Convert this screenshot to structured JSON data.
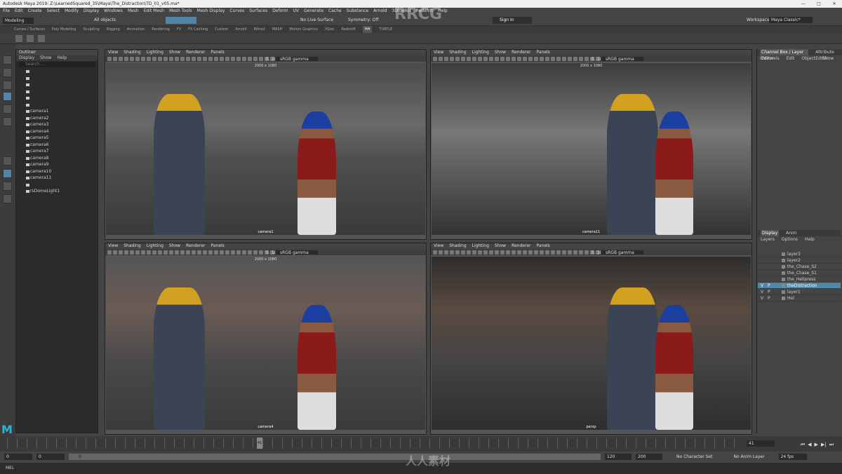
{
  "window": {
    "title": "Autodesk Maya 2019: Z:\\LearnedSquared_35\\Maya\\The_Distraction\\TD_01_v05.ma*",
    "min": "—",
    "max": "□",
    "close": "✕"
  },
  "menus": [
    "File",
    "Edit",
    "Create",
    "Select",
    "Modify",
    "Display",
    "Windows",
    "Mesh",
    "Edit Mesh",
    "Mesh Tools",
    "Mesh Display",
    "Curves",
    "Surfaces",
    "Deform",
    "UV",
    "Generate",
    "Cache",
    "Substance",
    "Arnold",
    "3Dtoolkit",
    "Redshift",
    "Help"
  ],
  "statusline": {
    "mode": "Modeling",
    "all_objects": "All objects",
    "symmetry": "Symmetry: Off",
    "no_live": "No Live Surface",
    "sign_in": "Sign In",
    "workspace_label": "Workspace :",
    "workspace": "Maya Classic*"
  },
  "shelf_tabs": [
    "Curves / Surfaces",
    "Poly Modeling",
    "Sculpting",
    "Rigging",
    "Animation",
    "Rendering",
    "FX",
    "FX Caching",
    "Custom",
    "Arnold",
    "Bifrost",
    "MASH",
    "Motion Graphics",
    "XGen",
    "Redshift",
    "HH",
    "TURTLE"
  ],
  "active_shelf_tab": "HH",
  "outliner": {
    "title": "Outliner",
    "menu": [
      "Display",
      "Show",
      "Help"
    ],
    "search": "Search...",
    "items": [
      "",
      "",
      "",
      "",
      "",
      "",
      "camera1",
      "camera2",
      "camera3",
      "camera4",
      "camera5",
      "camera6",
      "camera7",
      "camera8",
      "camera9",
      "camera10",
      "camera11",
      "",
      "rsDomeLight1"
    ]
  },
  "viewport_menu": [
    "View",
    "Shading",
    "Lighting",
    "Show",
    "Renderer",
    "Panels"
  ],
  "viewport_values": {
    "a": "0.00",
    "b": "1.00",
    "gamma": "sRGB gamma"
  },
  "viewports": [
    {
      "res": "2000 x 1080",
      "camera": "camera1"
    },
    {
      "res": "2000 x 1080",
      "camera": "camera11"
    },
    {
      "res": "2000 x 1080",
      "camera": "camera4"
    },
    {
      "res": "",
      "camera": "persp"
    }
  ],
  "channel_box": {
    "tabs": [
      "Channel Box / Layer Editor",
      "Attribute Editor"
    ],
    "menu": [
      "Channels",
      "Edit",
      "Object",
      "Show"
    ]
  },
  "layer_editor": {
    "tabs": [
      "Display",
      "Anim"
    ],
    "menu": [
      "Layers",
      "Options",
      "Help"
    ],
    "layers": [
      {
        "v": "",
        "p": "",
        "name": "layer3"
      },
      {
        "v": "",
        "p": "",
        "name": "layer2"
      },
      {
        "v": "",
        "p": "",
        "name": "the_Chase_S2"
      },
      {
        "v": "",
        "p": "",
        "name": "the_Chase_S1"
      },
      {
        "v": "",
        "p": "",
        "name": "the_Helipress"
      },
      {
        "v": "V",
        "p": "P",
        "name": "theDistraction",
        "selected": true
      },
      {
        "v": "V",
        "p": "P",
        "name": "layer1"
      },
      {
        "v": "V",
        "p": "P",
        "name": "Hel"
      }
    ]
  },
  "timeline": {
    "current": "41",
    "end_field": "41"
  },
  "range": {
    "start": "0",
    "start2": "0",
    "frame": "0",
    "r1": "120",
    "r2": "200",
    "char": "No Character Set",
    "anim": "No Anim Layer",
    "fps": "24 fps"
  },
  "cmd": {
    "label": "MEL"
  },
  "watermark": {
    "logo": "RRCG",
    "cn": "人人素材"
  }
}
